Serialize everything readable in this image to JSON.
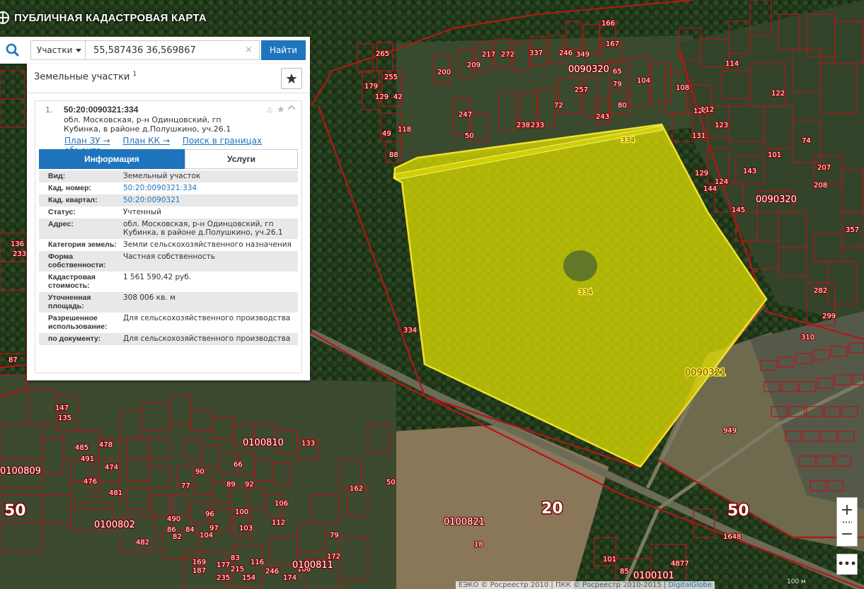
{
  "app": {
    "title": "ПУБЛИЧНАЯ КАДАСТРОВАЯ КАРТА"
  },
  "search": {
    "type_selected": "Участки",
    "query": "55,587436 36,569867",
    "clear_symbol": "×",
    "find_label": "Найти"
  },
  "results": {
    "heading": "Земельные участки",
    "count": "1",
    "item": {
      "number": "1.",
      "cadastral_number": "50:20:0090321:334",
      "address": "обл. Московская, р-н Одинцовский, гп Кубинка, в районе д.Полушкино, уч.26.1",
      "links": [
        "План ЗУ →",
        "План КК →",
        "Поиск в границах объекта →"
      ],
      "tabs": [
        "Информация",
        "Услуги"
      ],
      "fields": [
        {
          "key": "Вид:",
          "value": "Земельный участок",
          "link": false
        },
        {
          "key": "Кад. номер:",
          "value": "50:20:0090321:334",
          "link": true
        },
        {
          "key": "Кад. квартал:",
          "value": "50:20:0090321",
          "link": true
        },
        {
          "key": "Статус:",
          "value": "Учтенный",
          "link": false
        },
        {
          "key": "Адрес:",
          "value": "обл. Московская, р-н Одинцовский, гп Кубинка, в районе д.Полушкино, уч.26.1",
          "link": false
        },
        {
          "key": "Категория земель:",
          "value": "Земли сельскохозяйственного назначения",
          "link": false
        },
        {
          "key": "Форма собственности:",
          "value": "Частная собственность",
          "link": false
        },
        {
          "key": "Кадастровая стоимость:",
          "value": "1 561 590,42 руб.",
          "link": false
        },
        {
          "key": "Уточненная площадь:",
          "value": "308 006 кв. м",
          "link": false
        },
        {
          "key": "Разрешенное использование:",
          "value": "Для сельскохозяйственного производства",
          "link": false
        },
        {
          "key": "по документу:",
          "value": "Для сельскохозяйственного производства",
          "link": false
        }
      ]
    }
  },
  "map": {
    "selected_parcel_label": "334",
    "quarter_label_selected": "0090321",
    "quarter_labels": [
      "0090320",
      "0090320",
      "0100810",
      "0100809",
      "0100802",
      "0100821",
      "0100811",
      "0100101",
      "0090321"
    ],
    "region_labels": [
      "50",
      "50",
      "20"
    ],
    "parcel_labels": [
      "166",
      "167",
      "65",
      "79",
      "80",
      "108",
      "104",
      "114",
      "123",
      "122",
      "121",
      "112",
      "131",
      "124",
      "129",
      "144",
      "143",
      "145",
      "101",
      "74",
      "207",
      "208",
      "357",
      "282",
      "299",
      "310",
      "255",
      "265",
      "179",
      "129",
      "49",
      "42",
      "88",
      "118",
      "200",
      "209",
      "247",
      "50",
      "217",
      "272",
      "238",
      "233",
      "72",
      "337",
      "257",
      "246",
      "349",
      "243",
      "334",
      "949",
      "1648",
      "4877",
      "85",
      "101",
      "18",
      "172",
      "162",
      "79",
      "50",
      "77",
      "66",
      "103",
      "104",
      "96",
      "97",
      "100",
      "106",
      "112",
      "89",
      "92",
      "90",
      "133",
      "87",
      "147",
      "135",
      "136",
      "233",
      "485",
      "478",
      "491",
      "474",
      "476",
      "481",
      "482",
      "490",
      "82",
      "86",
      "84",
      "83",
      "215",
      "235",
      "246",
      "187",
      "169",
      "154",
      "177",
      "174",
      "116",
      "106",
      "123"
    ],
    "colors": {
      "boundary": "#b31717",
      "selected_fill": "#e8e600",
      "selected_stroke": "#f1e22a",
      "accent": "#1e74bd"
    }
  },
  "controls": {
    "zoom_in": "+",
    "zoom_out": "−",
    "more": "•••",
    "scale": "100 м",
    "attribution_prefix": "ЕЭКО © Росреестр 2010 | ПКК © Росреестр 2010-2015 | ",
    "attribution_link": "DigitalGlobe"
  }
}
